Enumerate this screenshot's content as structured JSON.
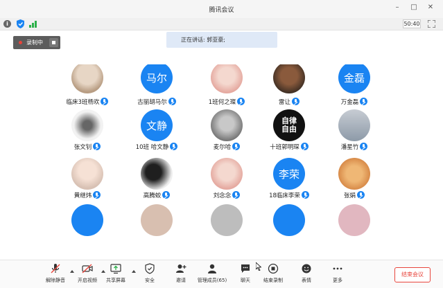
{
  "window": {
    "title": "腾讯会议"
  },
  "infobar": {
    "timer": "50:40"
  },
  "recording": {
    "label": "录制中"
  },
  "speaking": {
    "text": "正在讲话: 郭亚豪;"
  },
  "participants": [
    {
      "name": "临床3班杨欢",
      "avatar_type": "photo",
      "avatar_style": "pb",
      "avatar_text": ""
    },
    {
      "name": "古丽胡马尔",
      "avatar_type": "text",
      "avatar_style": "",
      "avatar_text": "马尔"
    },
    {
      "name": "1班何之璨",
      "avatar_type": "photo",
      "avatar_style": "pk",
      "avatar_text": ""
    },
    {
      "name": "雷让",
      "avatar_type": "photo",
      "avatar_style": "dk",
      "avatar_text": ""
    },
    {
      "name": "万金磊",
      "avatar_type": "text",
      "avatar_style": "",
      "avatar_text": "金磊"
    },
    {
      "name": "张文钊",
      "avatar_type": "photo",
      "avatar_style": "ink",
      "avatar_text": ""
    },
    {
      "name": "10班 哈文静",
      "avatar_type": "text",
      "avatar_style": "",
      "avatar_text": "文静"
    },
    {
      "name": "麦尔哈",
      "avatar_type": "photo",
      "avatar_style": "gr",
      "avatar_text": ""
    },
    {
      "name": "十班郭明琛",
      "avatar_type": "glyph",
      "avatar_style": "",
      "avatar_text": "自律\n自由"
    },
    {
      "name": "潘星竹",
      "avatar_type": "photo",
      "avatar_style": "st",
      "avatar_text": ""
    },
    {
      "name": "黄继炜",
      "avatar_type": "photo",
      "avatar_style": "sk",
      "avatar_text": ""
    },
    {
      "name": "高腾蛟",
      "avatar_type": "photo",
      "avatar_style": "bw",
      "avatar_text": ""
    },
    {
      "name": "刘念念",
      "avatar_type": "photo",
      "avatar_style": "pk",
      "avatar_text": ""
    },
    {
      "name": "18临床李荣",
      "avatar_type": "text",
      "avatar_style": "",
      "avatar_text": "李荣"
    },
    {
      "name": "张娟",
      "avatar_type": "photo",
      "avatar_style": "ct",
      "avatar_text": ""
    }
  ],
  "partial_row_colors": [
    "#1a84f2",
    "#d8bfb0",
    "#bdbdbd",
    "#1a84f2",
    "#e1b7c0"
  ],
  "toolbar": {
    "buttons": [
      {
        "id": "unmute",
        "label": "解除静音",
        "icon": "mic-muted-icon"
      },
      {
        "id": "video",
        "label": "开启视频",
        "icon": "camera-off-icon"
      },
      {
        "id": "share",
        "label": "共享屏幕",
        "icon": "share-screen-icon"
      },
      {
        "id": "security",
        "label": "安全",
        "icon": "shield-icon"
      },
      {
        "id": "invite",
        "label": "邀请",
        "icon": "invite-icon"
      },
      {
        "id": "members",
        "label": "管理成员(65)",
        "icon": "members-icon"
      },
      {
        "id": "chat",
        "label": "聊天",
        "icon": "chat-icon"
      },
      {
        "id": "end_record",
        "label": "结束录制",
        "icon": "stop-record-icon"
      },
      {
        "id": "reaction",
        "label": "表情",
        "icon": "emoji-icon"
      },
      {
        "id": "more",
        "label": "更多",
        "icon": "more-icon"
      }
    ],
    "end_meeting": "结束会议"
  },
  "colors": {
    "accent": "#1a84f2",
    "danger": "#e8443b",
    "banner": "#dfe9f7"
  }
}
